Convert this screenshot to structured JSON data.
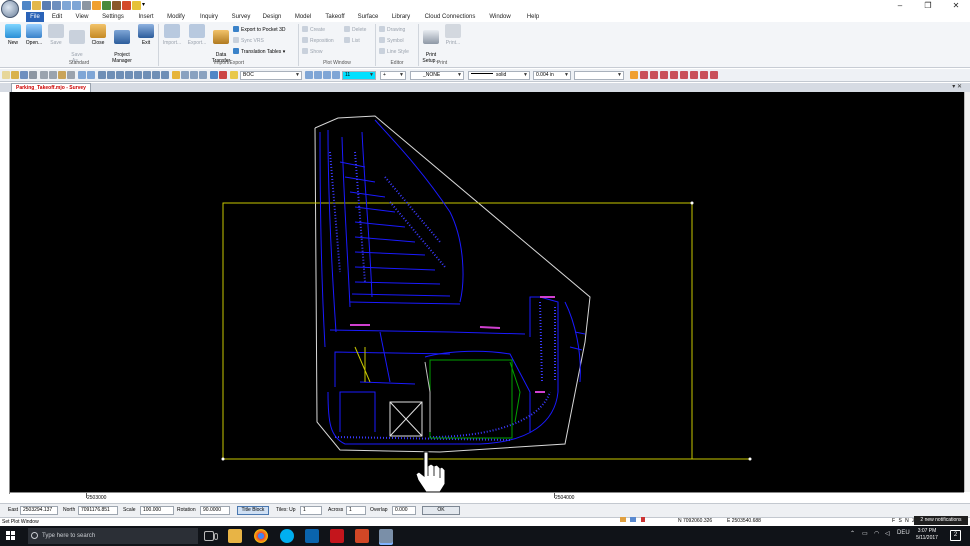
{
  "quick_access": [
    "app-menu-icon",
    "new-icon",
    "open-icon",
    "save-icon",
    "undo-icon",
    "redo-icon",
    "print-icon",
    "help-icon"
  ],
  "window_controls": {
    "minimize": "–",
    "restore": "❐",
    "close": "✕"
  },
  "menu": [
    "File",
    "Edit",
    "View",
    "Settings",
    "Insert",
    "Modify",
    "Inquiry",
    "Survey",
    "Design",
    "Model",
    "Takeoff",
    "Surface",
    "Library",
    "Cloud Connections",
    "Window",
    "Help"
  ],
  "ribbon": {
    "standard": {
      "label": "Standard",
      "new": "New",
      "open": "Open...",
      "save": "Save",
      "save_as": "Save\nAs...",
      "close": "Close",
      "project_manager": "Project\nManager",
      "exit": "Exit"
    },
    "import_export": {
      "label": "Import/Export",
      "import": "Import...",
      "export": "Export...",
      "data_transfer": "Data\nTransfer",
      "export_pocket": "Export to Pocket 3D",
      "sync_vrs": "Sync VRS",
      "translation_tables": "Translation Tables"
    },
    "plot_window": {
      "label": "Plot Window",
      "create": "Create",
      "reposition": "Reposition",
      "show": "Show",
      "delete": "Delete",
      "list": "List"
    },
    "editor": {
      "label": "Editor",
      "drawing": "Drawing",
      "symbol": "Symbol",
      "line_style": "Line Style"
    },
    "print": {
      "label": "Print",
      "print_setup": "Print\nSetup...",
      "print": "Print..."
    }
  },
  "toolbar": {
    "layer": "BOC",
    "color_value": "11",
    "point_symbol": "+",
    "text_style": "_NONE",
    "line_style": "solid",
    "line_width": "0.004 in",
    "extra": ""
  },
  "document_tab": "Parking_Takeoff.mjo - Survey",
  "ruler": {
    "x_labels": [
      "2503000",
      "2504000"
    ]
  },
  "input_bar": {
    "east_label": "East",
    "east_value": "2503294.137",
    "north_label": "North",
    "north_value": "7091176.851",
    "scale_label": "Scale",
    "scale_value": "100.000",
    "rotation_label": "Rotation",
    "rotation_value": "90.0000",
    "title_block": "Title Block",
    "tiles_up_label": "Tiles: Up",
    "tiles_up_value": "1",
    "across_label": "Across",
    "across_value": "1",
    "overlap_label": "Overlap",
    "overlap_value": "0.000",
    "ok": "OK"
  },
  "status": {
    "command": "Set Plot Window",
    "north_coord": "N 7092060.326",
    "east_coord": "E 2503540.688",
    "snap_flags": "F S N Z",
    "notification": "2 new notifications"
  },
  "taskbar": {
    "search_placeholder": "Type here to search",
    "language": "DEU",
    "time": "3:07 PM",
    "date": "5/11/2017"
  },
  "colors": {
    "accent": "#2a63b8",
    "canvas_bg": "#000000",
    "plot_window": "#c8c800",
    "linework": "#1a1aff",
    "boundary": "#dddddd"
  }
}
